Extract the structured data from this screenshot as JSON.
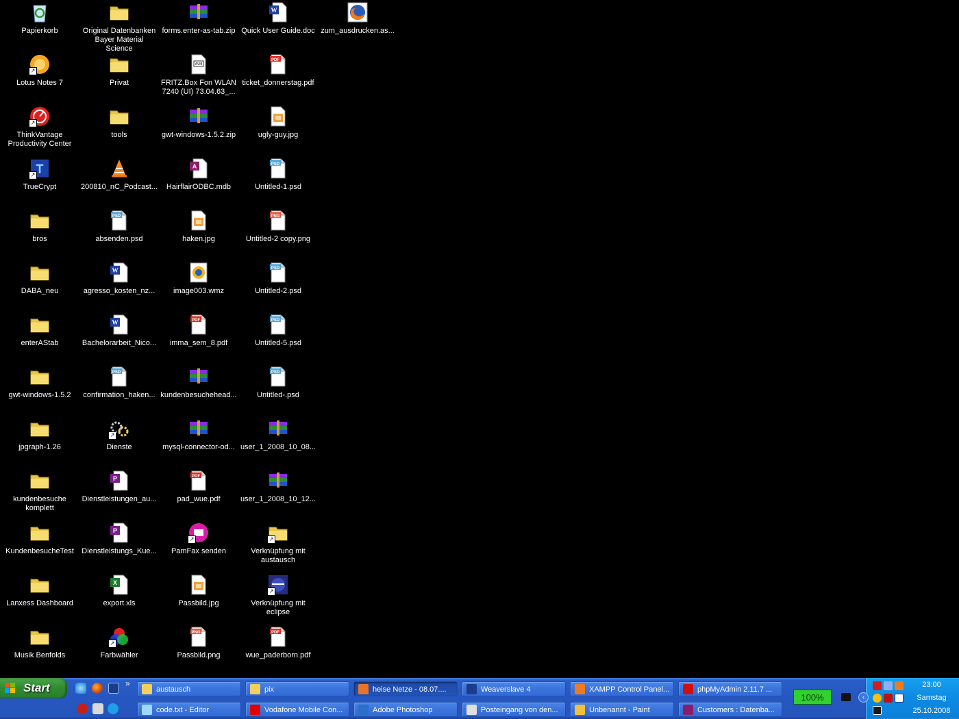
{
  "desktop": {
    "icons": [
      {
        "label": "Papierkorb",
        "type": "recycle"
      },
      {
        "label": "Lotus Notes 7",
        "type": "lotus",
        "shortcut": true
      },
      {
        "label": "ThinkVantage\nProductivity Center",
        "type": "thinkvantage",
        "shortcut": true
      },
      {
        "label": "TrueCrypt",
        "type": "truecrypt",
        "shortcut": true
      },
      {
        "label": "bros",
        "type": "folder"
      },
      {
        "label": "DABA_neu",
        "type": "folder"
      },
      {
        "label": "enterAStab",
        "type": "folder"
      },
      {
        "label": "gwt-windows-1.5.2",
        "type": "folder"
      },
      {
        "label": "jpgraph-1.26",
        "type": "folder"
      },
      {
        "label": "kundenbesuche\nkomplett",
        "type": "folder"
      },
      {
        "label": "KundenbesucheTest",
        "type": "folder"
      },
      {
        "label": "Lanxess Dashboard",
        "type": "folder"
      },
      {
        "label": "Musik Benfolds",
        "type": "folder"
      },
      {
        "label": "Original Datenbanken\nBayer Material Science",
        "type": "folder"
      },
      {
        "label": "Privat",
        "type": "folder"
      },
      {
        "label": "tools",
        "type": "folder"
      },
      {
        "label": "200810_nC_Podcast...",
        "type": "vlc"
      },
      {
        "label": "absenden.psd",
        "type": "psd"
      },
      {
        "label": "agresso_kosten_nz...",
        "type": "doc"
      },
      {
        "label": "Bachelorarbeit_Nico...",
        "type": "doc"
      },
      {
        "label": "confirmation_haken...",
        "type": "psd"
      },
      {
        "label": "Dienste",
        "type": "services",
        "shortcut": true
      },
      {
        "label": "Dienstleistungen_au...",
        "type": "publisher"
      },
      {
        "label": "Dienstleistungs_Kue...",
        "type": "publisher"
      },
      {
        "label": "export.xls",
        "type": "xls"
      },
      {
        "label": "Farbwähler",
        "type": "colorpicker",
        "shortcut": true
      },
      {
        "label": "forms.enter-as-tab.zip",
        "type": "zip"
      },
      {
        "label": "FRITZ.Box Fon WLAN\n7240 (UI) 73.04.63_...",
        "type": "image"
      },
      {
        "label": "gwt-windows-1.5.2.zip",
        "type": "zip"
      },
      {
        "label": "HairflairODBC.mdb",
        "type": "mdb"
      },
      {
        "label": "haken.jpg",
        "type": "jpg"
      },
      {
        "label": "image003.wmz",
        "type": "wmz"
      },
      {
        "label": "imma_sem_8.pdf",
        "type": "pdf"
      },
      {
        "label": "kundenbesuchehead...",
        "type": "zip"
      },
      {
        "label": "mysql-connector-od...",
        "type": "zip"
      },
      {
        "label": "pad_wue.pdf",
        "type": "pdf"
      },
      {
        "label": "PamFax senden",
        "type": "pamfax",
        "shortcut": true
      },
      {
        "label": "Passbild.jpg",
        "type": "jpg"
      },
      {
        "label": "Passbild.png",
        "type": "png"
      },
      {
        "label": "Quick User Guide.doc",
        "type": "doc"
      },
      {
        "label": "ticket_donnerstag.pdf",
        "type": "pdf"
      },
      {
        "label": "ugly-guy.jpg",
        "type": "jpg"
      },
      {
        "label": "Untitled-1.psd",
        "type": "psd"
      },
      {
        "label": "Untitled-2 copy.png",
        "type": "png"
      },
      {
        "label": "Untitled-2.psd",
        "type": "psd"
      },
      {
        "label": "Untitled-5.psd",
        "type": "psd"
      },
      {
        "label": "Untitled-.psd",
        "type": "psd"
      },
      {
        "label": "user_1_2008_10_08...",
        "type": "zip"
      },
      {
        "label": "user_1_2008_10_12...",
        "type": "zip"
      },
      {
        "label": "Verknüpfung mit\naustausch",
        "type": "folder",
        "shortcut": true
      },
      {
        "label": "Verknüpfung mit\neclipse",
        "type": "eclipse",
        "shortcut": true
      },
      {
        "label": "wue_paderborn.pdf",
        "type": "pdf"
      },
      {
        "label": "zum_ausdrucken.as...",
        "type": "firefox"
      }
    ]
  },
  "taskbar": {
    "start_label": "Start",
    "chevron": "»",
    "buttons_row1": [
      {
        "label": "austausch",
        "icon": "folder-icon",
        "active": false
      },
      {
        "label": "pix",
        "icon": "folder-icon",
        "active": false
      },
      {
        "label": "heise Netze - 08.07....",
        "icon": "firefox-icon",
        "active": true
      },
      {
        "label": "Weaverslave 4",
        "icon": "weaverslave-icon",
        "active": false
      },
      {
        "label": "XAMPP Control Panel...",
        "icon": "xampp-icon",
        "active": false
      },
      {
        "label": "phpMyAdmin 2.11.7 ...",
        "icon": "opera-icon",
        "active": false
      }
    ],
    "buttons_row2": [
      {
        "label": "code.txt - Editor",
        "icon": "notepad-icon",
        "active": false
      },
      {
        "label": "Vodafone Mobile Con...",
        "icon": "vodafone-icon",
        "active": false
      },
      {
        "label": "Adobe Photoshop",
        "icon": "photoshop-icon",
        "active": false
      },
      {
        "label": "Posteingang von den...",
        "icon": "mail-icon",
        "active": false
      },
      {
        "label": "Unbenannt - Paint",
        "icon": "paint-icon",
        "active": false
      },
      {
        "label": "Customers : Datenba...",
        "icon": "access-icon",
        "active": false
      }
    ],
    "battery_label": "100%",
    "clock": {
      "time": "23:00",
      "day": "Samstag",
      "date": "25.10.2008"
    }
  }
}
